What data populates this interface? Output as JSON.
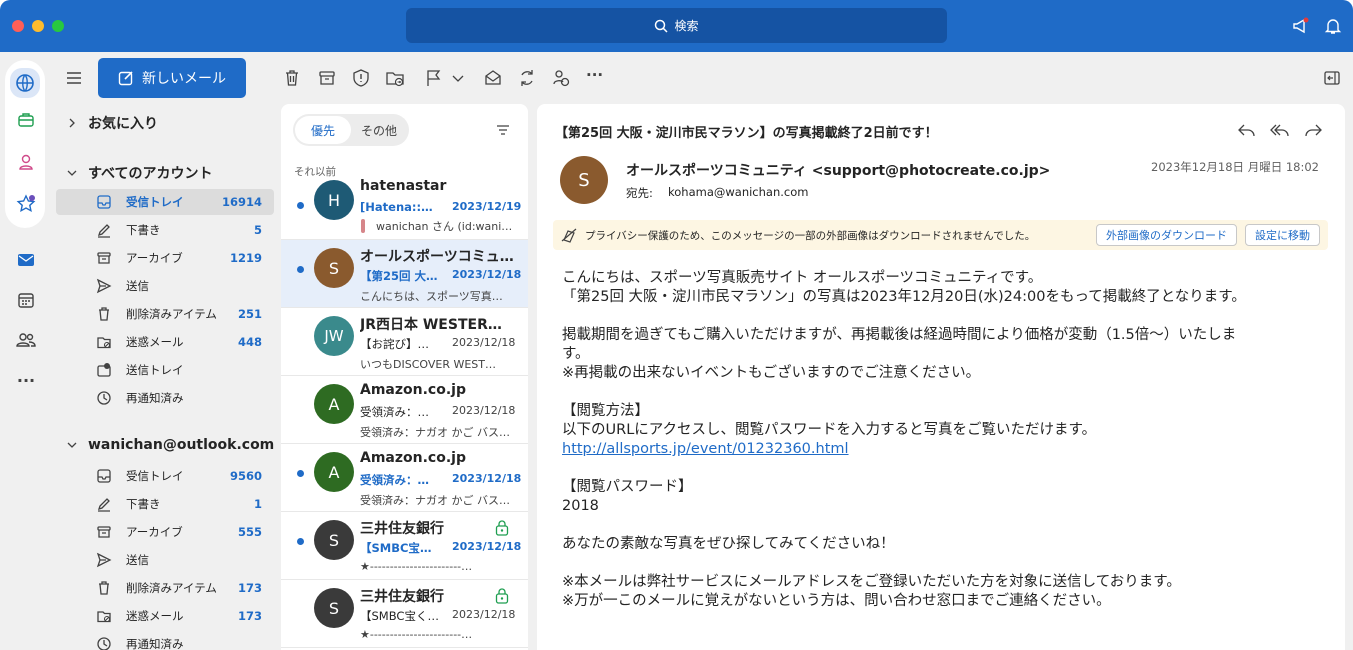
{
  "titlebar": {
    "search_label": "検索"
  },
  "toolbar": {
    "new_mail_label": "新しいメール"
  },
  "folders": {
    "favorites_label": "お気に入り",
    "all_accounts_label": "すべてのアカウント",
    "all_accounts_items": [
      {
        "label": "受信トレイ",
        "count": "16914"
      },
      {
        "label": "下書き",
        "count": "5"
      },
      {
        "label": "アーカイブ",
        "count": "1219"
      },
      {
        "label": "送信",
        "count": ""
      },
      {
        "label": "削除済みアイテム",
        "count": "251"
      },
      {
        "label": "迷惑メール",
        "count": "448"
      },
      {
        "label": "送信トレイ",
        "count": ""
      },
      {
        "label": "再通知済み",
        "count": ""
      }
    ],
    "account_label": "wanichan@outlook.com",
    "account_items": [
      {
        "label": "受信トレイ",
        "count": "9560"
      },
      {
        "label": "下書き",
        "count": "1"
      },
      {
        "label": "アーカイブ",
        "count": "555"
      },
      {
        "label": "送信",
        "count": ""
      },
      {
        "label": "削除済みアイテム",
        "count": "173"
      },
      {
        "label": "迷惑メール",
        "count": "173"
      },
      {
        "label": "再通知済み",
        "count": ""
      }
    ]
  },
  "list": {
    "tab_focused": "優先",
    "tab_other": "その他",
    "group_label": "それ以前",
    "messages": [
      {
        "initial": "H",
        "sender": "hatenastar",
        "subject": "[Hatena::S]…",
        "date": "2023/12/19",
        "preview": "wanichan さん (id:wani…",
        "color": "#1e5a75"
      },
      {
        "initial": "S",
        "sender": "オールスポーツコミュ…",
        "subject": "【第25回 大…",
        "date": "2023/12/18",
        "preview": "こんにちは、スポーツ写真…",
        "color": "#8a5a2e"
      },
      {
        "initial": "JW",
        "sender": "JR西日本 WESTER…",
        "subject": "【お詫び】メー…",
        "date": "2023/12/18",
        "preview": "いつもDISCOVER WEST…",
        "color": "#3a8a8c"
      },
      {
        "initial": "A",
        "sender": "Amazon.co.jp",
        "subject": "受領済み：ナ…",
        "date": "2023/12/18",
        "preview": "受領済み：ナガオ かご バス…",
        "color": "#2e6b22"
      },
      {
        "initial": "A",
        "sender": "Amazon.co.jp",
        "subject": "受領済み：ナ…",
        "date": "2023/12/18",
        "preview": "受領済み：ナガオ かご バス…",
        "color": "#2e6b22"
      },
      {
        "initial": "S",
        "sender": "三井住友銀行",
        "subject": "【SMBC宝く…",
        "date": "2023/12/18",
        "preview": "★-----------------------…",
        "color": "#3a3a3a"
      },
      {
        "initial": "S",
        "sender": "三井住友銀行",
        "subject": "【SMBC宝く…",
        "date": "2023/12/18",
        "preview": "★-----------------------…",
        "color": "#3a3a3a"
      }
    ]
  },
  "reader": {
    "subject": "【第25回 大阪・淀川市民マラソン】の写真掲載終了2日前です！",
    "sender_initial": "S",
    "from": "オールスポーツコミュニティ <support@photocreate.co.jp>",
    "to_label": "宛先:",
    "to": "kohama@wanichan.com",
    "date": "2023年12月18日 月曜日 18:02",
    "banner_text": "プライバシー保護のため、このメッセージの一部の外部画像はダウンロードされませんでした。",
    "banner_download": "外部画像のダウンロード",
    "banner_settings": "設定に移動",
    "body": [
      "こんにちは、スポーツ写真販売サイト オールスポーツコミュニティです。",
      "「第25回 大阪・淀川市民マラソン」の写真は2023年12月20日(水)24:00をもって掲載終了となります。",
      "",
      "掲載期間を過ぎてもご購入いただけますが、再掲載後は経過時間により価格が変動（1.5倍〜）いたしま",
      "す。",
      "※再掲載の出来ないイベントもございますのでご注意ください。",
      "",
      "【閲覧方法】",
      "以下のURLにアクセスし、閲覧パスワードを入力すると写真をご覧いただけます。",
      "http://allsports.jp/event/01232360.html",
      "",
      "【閲覧パスワード】",
      "2018",
      "",
      "あなたの素敵な写真をぜひ探してみてくださいね！",
      "",
      "※本メールは弊社サービスにメールアドレスをご登録いただいた方を対象に送信しております。",
      "※万が一このメールに覚えがないという方は、問い合わせ窓口までご連絡ください。"
    ]
  }
}
